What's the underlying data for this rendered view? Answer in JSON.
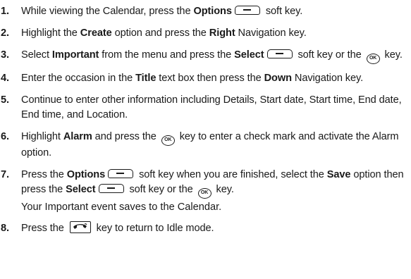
{
  "steps": [
    {
      "number": "1.",
      "parts": [
        "While viewing the Calendar, press the ",
        "Options",
        " soft key."
      ]
    },
    {
      "number": "2.",
      "parts": [
        "Highlight the ",
        "Create",
        " option and press the ",
        "Right",
        " Navigation key."
      ]
    },
    {
      "number": "3.",
      "parts": [
        "Select ",
        "Important",
        " from the menu and press the ",
        "Select",
        " soft key or the ",
        " key."
      ]
    },
    {
      "number": "4.",
      "parts": [
        "Enter the occasion in the ",
        "Title",
        " text box then press the ",
        "Down",
        " Navigation key."
      ]
    },
    {
      "number": "5.",
      "parts": [
        "Continue to enter other information including Details, Start date, Start time, End date, End time, and Location."
      ]
    },
    {
      "number": "6.",
      "parts": [
        "Highlight ",
        "Alarm",
        " and press the ",
        " key to enter a check mark and activate the Alarm option."
      ]
    },
    {
      "number": "7.",
      "parts": [
        "Press the ",
        "Options",
        " soft key when you are finished, select the ",
        "Save",
        " option then press the ",
        "Select",
        " soft key or the ",
        " key."
      ],
      "note": "Your Important event saves to the Calendar."
    },
    {
      "number": "8.",
      "parts": [
        "Press the ",
        " key to return to Idle mode."
      ]
    }
  ],
  "icons": {
    "soft_key": "soft-key-icon",
    "ok_key": "ok-key-icon",
    "ok_key_label": "OK",
    "end_key": "end-key-icon"
  }
}
